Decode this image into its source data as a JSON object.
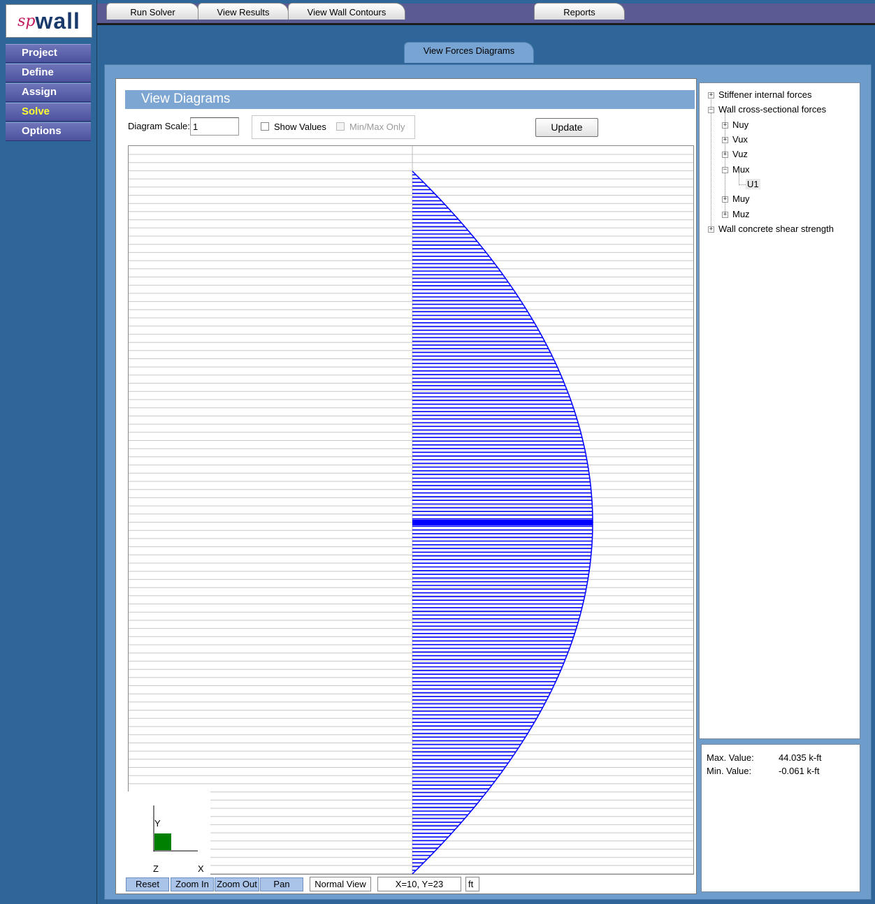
{
  "logo": {
    "sp": "sp",
    "wall": "wall"
  },
  "nav": {
    "items": [
      {
        "label": "Project"
      },
      {
        "label": "Define"
      },
      {
        "label": "Assign"
      },
      {
        "label": "Solve"
      },
      {
        "label": "Options"
      }
    ],
    "active": "Solve"
  },
  "tabs": {
    "items": [
      {
        "label": "Run Solver"
      },
      {
        "label": "View Results"
      },
      {
        "label": "View Wall Contours"
      },
      {
        "label": "View Forces Diagrams"
      },
      {
        "label": "Reports"
      }
    ],
    "active": "View Forces Diagrams"
  },
  "diagrams": {
    "title": "View Diagrams",
    "scale_label": "Diagram Scale:",
    "scale_value": "1",
    "show_values_label": "Show Values",
    "show_values_checked": false,
    "minmax_label": "Min/Max Only",
    "minmax_checked": false,
    "update_label": "Update"
  },
  "axis": {
    "y": "Y",
    "z": "Z",
    "x": "X"
  },
  "toolbar": {
    "reset": "Reset",
    "zoom_in": "Zoom In",
    "zoom_out": "Zoom Out",
    "pan": "Pan",
    "view_mode": "Normal View",
    "coords": "X=10, Y=23",
    "units": "ft"
  },
  "tree": {
    "stiffener": "Stiffener internal forces",
    "wall_forces": "Wall cross-sectional forces",
    "nuy": "Nuy",
    "vux": "Vux",
    "vuz": "Vuz",
    "mux": "Mux",
    "u1": "U1",
    "muy": "Muy",
    "muz": "Muz",
    "shear": "Wall concrete shear strength"
  },
  "values": {
    "max_label": "Max. Value:",
    "max_value": "44.035 k-ft",
    "min_label": "Min. Value:",
    "min_value": "-0.061 k-ft"
  },
  "colors": {
    "diagram": "#0000ff",
    "axis_rect": "#008000",
    "accent_active_nav": "#ffff33"
  },
  "diagram_data": {
    "quantity": "Mux",
    "load_case": "U1",
    "max": 44.035,
    "min": -0.061,
    "height_ft": 23,
    "peak_at_ft": 11.5
  }
}
